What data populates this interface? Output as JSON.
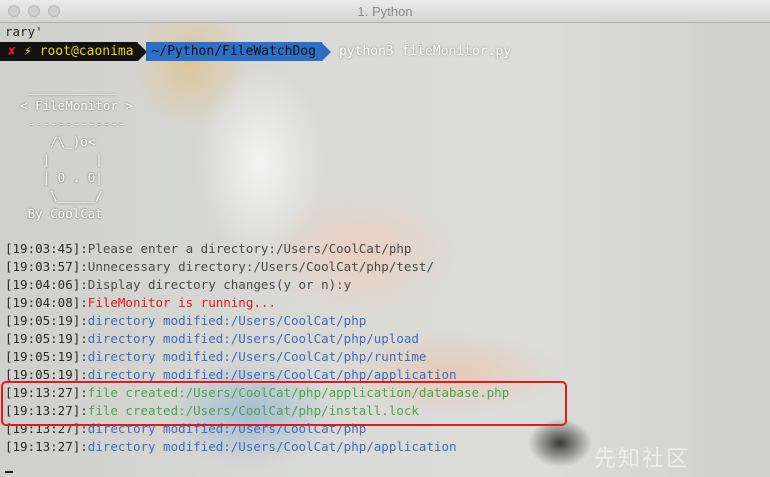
{
  "window": {
    "title": "1. Python"
  },
  "terminal": {
    "first_line": "rary'",
    "prompt": {
      "x_icon": "✘",
      "bolt_icon": "⚡",
      "user_host": "root@caonima",
      "path": "~/Python/FileWatchDog",
      "command": "python3 fileMonitor.py"
    },
    "banner": [
      "   ____________",
      "  < FileMonitor >",
      "   -------------",
      "      /\\_)o<",
      "     |      |",
      "     | O . O|",
      "      \\_____/",
      "   By CoolCat"
    ],
    "log": [
      {
        "time": "[19:03:45]",
        "sep": ":",
        "text": "Please enter a directory:/Users/CoolCat/php",
        "color": "gray"
      },
      {
        "time": "[19:03:57]",
        "sep": ":",
        "text": "Unnecessary directory:/Users/CoolCat/php/test/",
        "color": "gray"
      },
      {
        "time": "[19:04:06]",
        "sep": ":",
        "text": "Display directory changes(y or n):y",
        "color": "gray"
      },
      {
        "time": "[19:04:08]",
        "sep": ":",
        "text": "FileMonitor is running...",
        "color": "red"
      },
      {
        "time": "[19:05:19]",
        "sep": ":",
        "text": "directory modified:/Users/CoolCat/php",
        "color": "blue"
      },
      {
        "time": "[19:05:19]",
        "sep": ":",
        "text": "directory modified:/Users/CoolCat/php/upload",
        "color": "blue"
      },
      {
        "time": "[19:05:19]",
        "sep": ":",
        "text": "directory modified:/Users/CoolCat/php/runtime",
        "color": "blue"
      },
      {
        "time": "[19:05:19]",
        "sep": ":",
        "text": "directory modified:/Users/CoolCat/php/application",
        "color": "blue"
      },
      {
        "time": "[19:13:27]",
        "sep": ":",
        "text": "file created:/Users/CoolCat/php/application/database.php",
        "color": "green"
      },
      {
        "time": "[19:13:27]",
        "sep": ":",
        "text": "file created:/Users/CoolCat/php/install.lock",
        "color": "green"
      },
      {
        "time": "[19:13:27]",
        "sep": ":",
        "text": "directory modified:/Users/CoolCat/php",
        "color": "blue"
      },
      {
        "time": "[19:13:27]",
        "sep": ":",
        "text": "directory modified:/Users/CoolCat/php/application",
        "color": "blue"
      }
    ]
  },
  "watermark": "先知社区",
  "colors": {
    "highlight_box": "#e5191c",
    "prompt_path_bg": "#2d6fc6",
    "log_red": "#e0191b",
    "log_blue": "#3a6ebe",
    "log_green": "#47a84a"
  }
}
